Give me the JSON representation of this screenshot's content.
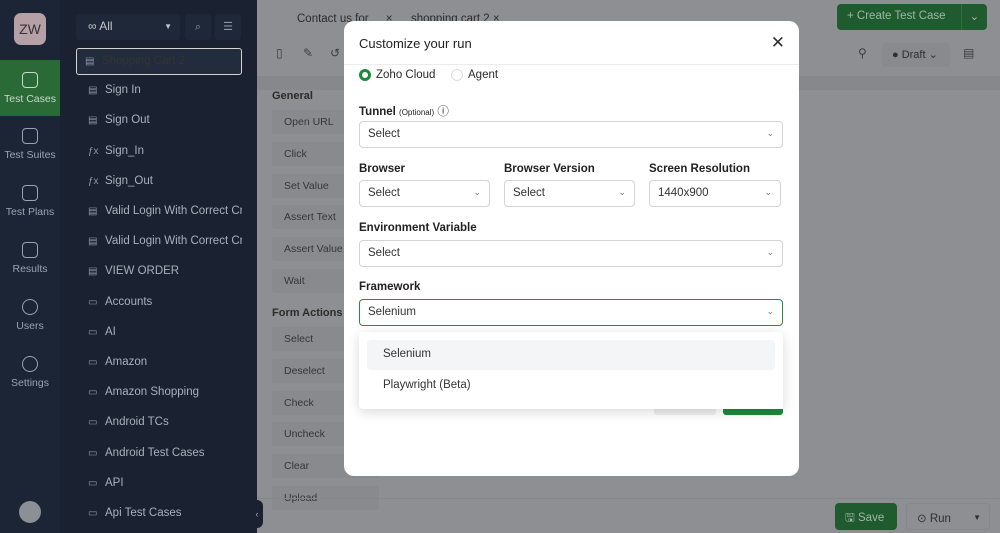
{
  "rail": {
    "avatar": "ZW",
    "items": [
      {
        "label": "Test Cases",
        "active": true
      },
      {
        "label": "Test Suites"
      },
      {
        "label": "Test Plans"
      },
      {
        "label": "Results"
      },
      {
        "label": "Users"
      },
      {
        "label": "Settings"
      }
    ]
  },
  "tree": {
    "filter": "All",
    "items": [
      {
        "label": "Shopping Cart 2",
        "icon": "test-case-icon",
        "selected": true
      },
      {
        "label": "Sign In",
        "icon": "test-case-icon"
      },
      {
        "label": "Sign Out",
        "icon": "test-case-icon"
      },
      {
        "label": "Sign_In",
        "icon": "function-icon"
      },
      {
        "label": "Sign_Out",
        "icon": "function-icon"
      },
      {
        "label": "Valid Login With Correct Cre",
        "icon": "test-case-icon"
      },
      {
        "label": "Valid Login With Correct Cre",
        "icon": "test-case-icon"
      },
      {
        "label": "VIEW ORDER",
        "icon": "test-case-icon"
      },
      {
        "label": "Accounts",
        "icon": "folder-icon"
      },
      {
        "label": "AI",
        "icon": "folder-icon"
      },
      {
        "label": "Amazon",
        "icon": "folder-icon"
      },
      {
        "label": "Amazon Shopping",
        "icon": "folder-icon"
      },
      {
        "label": "Android TCs",
        "icon": "folder-icon"
      },
      {
        "label": "Android Test Cases",
        "icon": "folder-icon"
      },
      {
        "label": "API",
        "icon": "folder-icon"
      },
      {
        "label": "Api Test Cases",
        "icon": "folder-icon"
      }
    ]
  },
  "tabs": [
    {
      "label": "Contact us for"
    },
    {
      "label": "shopping cart 2"
    }
  ],
  "header": {
    "create": "Create Test Case",
    "status": "Draft"
  },
  "actions": {
    "general_title": "General",
    "general": [
      "Open URL",
      "Click",
      "Set Value",
      "Assert Text",
      "Assert Value",
      "Wait"
    ],
    "form_title": "Form Actions",
    "form": [
      "Select",
      "Deselect",
      "Check",
      "Uncheck",
      "Clear",
      "Upload"
    ]
  },
  "footer": {
    "save": "Save",
    "run": "Run"
  },
  "modal": {
    "title": "Customize your run",
    "env_options": [
      {
        "label": "Zoho Cloud",
        "selected": true
      },
      {
        "label": "Agent",
        "selected": false
      }
    ],
    "tunnel": {
      "label": "Tunnel",
      "hint": "(Optional)",
      "value": "Select"
    },
    "browser": {
      "label": "Browser",
      "value": "Select"
    },
    "browser_version": {
      "label": "Browser Version",
      "value": "Select"
    },
    "resolution": {
      "label": "Screen Resolution",
      "value": "1440x900"
    },
    "env_var": {
      "label": "Environment Variable",
      "value": "Select"
    },
    "framework": {
      "label": "Framework",
      "value": "Selenium",
      "options": [
        "Selenium",
        "Playwright (Beta)"
      ]
    }
  },
  "colors": {
    "accent": "#1c8a3c",
    "rail": "#1c2535",
    "tree": "#1a2232"
  }
}
